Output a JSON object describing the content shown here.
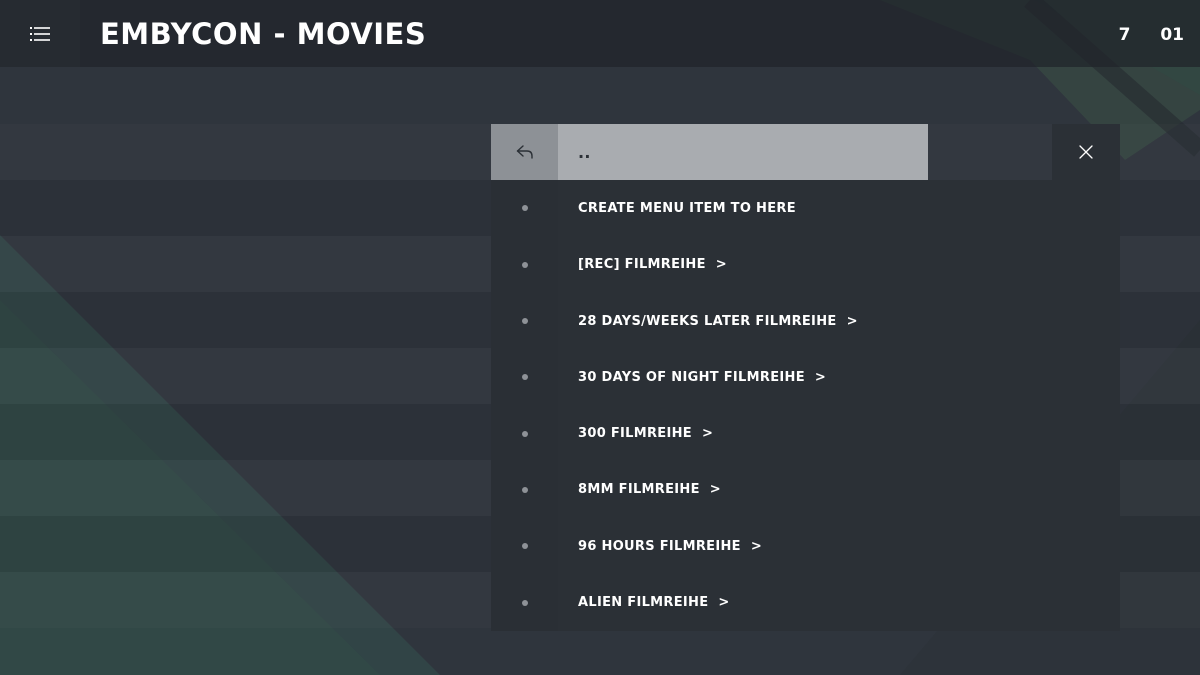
{
  "header": {
    "title": "EMBYCON - MOVIES",
    "clock": {
      "hours": "7",
      "minutes": "01"
    },
    "menu_icon": "list-icon"
  },
  "browser": {
    "parent": {
      "label": "..",
      "icon": "back-arrow-icon"
    },
    "close_icon": "close-icon",
    "items": [
      {
        "label": "CREATE MENU ITEM TO HERE",
        "suffix": ""
      },
      {
        "label": "[REC] FILMREIHE",
        "suffix": ">"
      },
      {
        "label": "28 DAYS/WEEKS LATER FILMREIHE",
        "suffix": ">"
      },
      {
        "label": "30 DAYS OF NIGHT FILMREIHE",
        "suffix": ">"
      },
      {
        "label": "300 FILMREIHE",
        "suffix": ">"
      },
      {
        "label": "8MM FILMREIHE",
        "suffix": ">"
      },
      {
        "label": "96 HOURS FILMREIHE",
        "suffix": ">"
      },
      {
        "label": "ALIEN FILMREIHE",
        "suffix": ">"
      }
    ]
  },
  "colors": {
    "background": "#2f353d",
    "accent_green": "#3a5a4d",
    "selected_row": "#a9acb0"
  }
}
